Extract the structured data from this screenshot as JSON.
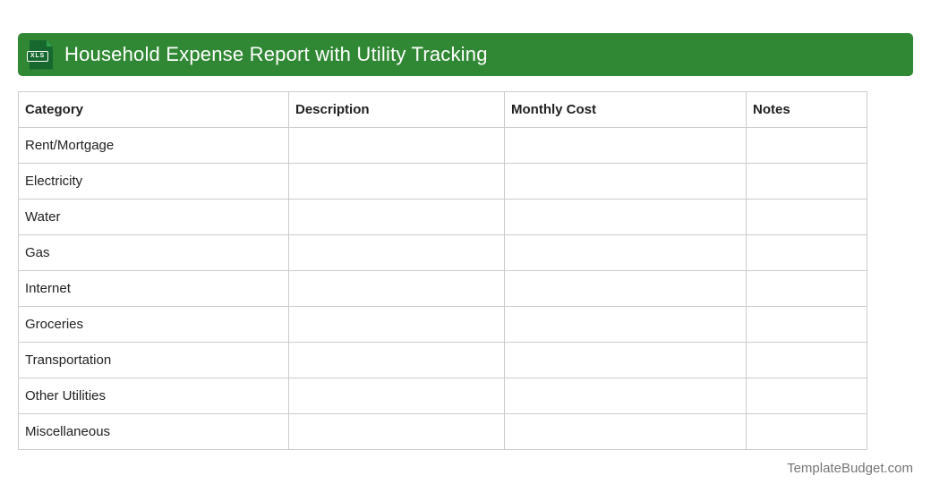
{
  "banner": {
    "title": "Household Expense Report with Utility Tracking",
    "background_color": "#318834",
    "icon": {
      "name": "xls-file-icon",
      "badge_label": "XLS",
      "doc_color": "#17682e"
    }
  },
  "table": {
    "columns": [
      "Category",
      "Description",
      "Monthly Cost",
      "Notes"
    ],
    "rows": [
      {
        "category": "Rent/Mortgage",
        "description": "",
        "monthly_cost": "",
        "notes": ""
      },
      {
        "category": "Electricity",
        "description": "",
        "monthly_cost": "",
        "notes": ""
      },
      {
        "category": "Water",
        "description": "",
        "monthly_cost": "",
        "notes": ""
      },
      {
        "category": "Gas",
        "description": "",
        "monthly_cost": "",
        "notes": ""
      },
      {
        "category": "Internet",
        "description": "",
        "monthly_cost": "",
        "notes": ""
      },
      {
        "category": "Groceries",
        "description": "",
        "monthly_cost": "",
        "notes": ""
      },
      {
        "category": "Transportation",
        "description": "",
        "monthly_cost": "",
        "notes": ""
      },
      {
        "category": "Other Utilities",
        "description": "",
        "monthly_cost": "",
        "notes": ""
      },
      {
        "category": "Miscellaneous",
        "description": "",
        "monthly_cost": "",
        "notes": ""
      }
    ]
  },
  "footer": {
    "brand": "TemplateBudget.com"
  }
}
